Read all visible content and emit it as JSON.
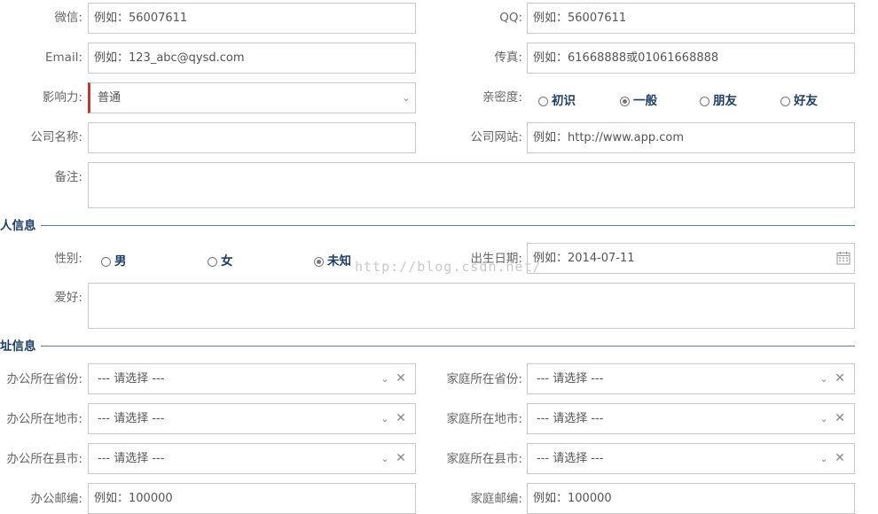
{
  "contact": {
    "wechat_label": "微信:",
    "wechat_placeholder": "例如：56007611",
    "qq_label": "QQ:",
    "qq_placeholder": "例如：56007611",
    "email_label": "Email:",
    "email_placeholder": "例如：123_abc@qysd.com",
    "fax_label": "传真:",
    "fax_placeholder": "例如：61668888或01061668888",
    "influence_label": "影响力:",
    "influence_value": "普通",
    "intimacy_label": "亲密度:",
    "intimacy_options": [
      "初识",
      "一般",
      "朋友",
      "好友"
    ],
    "intimacy_selected": "一般",
    "company_label": "公司名称:",
    "company_value": "",
    "website_label": "公司网站:",
    "website_placeholder": "例如：http://www.app.com",
    "remark_label": "备注:",
    "remark_value": ""
  },
  "personal": {
    "section_title": "人信息",
    "gender_label": "性别:",
    "gender_options": [
      "男",
      "女",
      "未知"
    ],
    "gender_selected": "未知",
    "birthday_label": "出生日期:",
    "birthday_placeholder": "例如：2014-07-11",
    "hobby_label": "爱好:",
    "hobby_value": ""
  },
  "address": {
    "section_title": "址信息",
    "office_province_label": "办公所在省份:",
    "office_city_label": "办公所在地市:",
    "office_county_label": "办公所在县市:",
    "office_zip_label": "办公邮编:",
    "home_province_label": "家庭所在省份:",
    "home_city_label": "家庭所在地市:",
    "home_county_label": "家庭所在县市:",
    "home_zip_label": "家庭邮编:",
    "select_placeholder": "--- 请选择 ---",
    "zip_placeholder": "例如：100000"
  },
  "watermark": "http://blog.csdn.net/",
  "icons": {
    "chevron": "chevron-down-icon",
    "clear": "clear-icon",
    "calendar": "calendar-icon"
  },
  "colors": {
    "section_title": "#1e3f66",
    "section_line": "#5d7fa6",
    "required_mark": "#c0392b",
    "border": "#c9c9c9"
  }
}
